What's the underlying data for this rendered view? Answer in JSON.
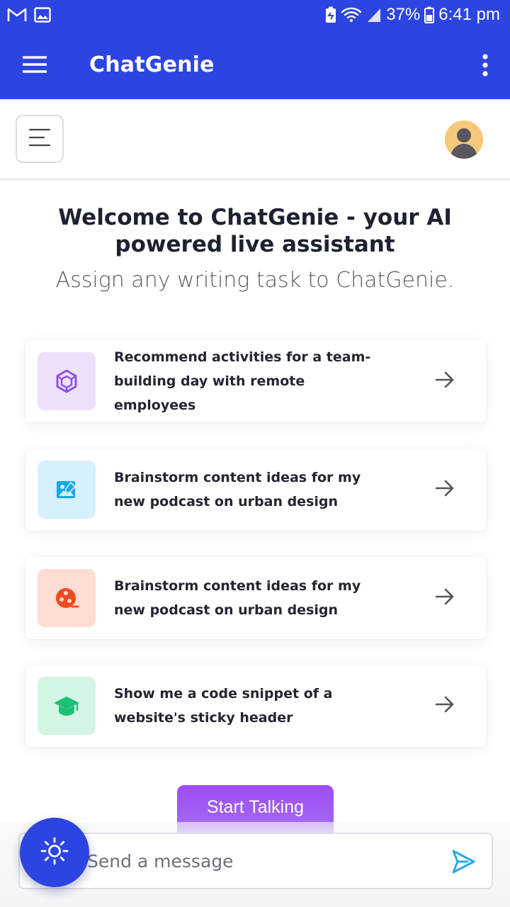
{
  "status_bar": {
    "battery": "37%",
    "time": "6:41 pm",
    "icons": [
      "gmail-icon",
      "gallery-icon",
      "battery-saver-icon",
      "wifi-icon",
      "signal-icon",
      "battery-icon"
    ]
  },
  "app_bar": {
    "title": "ChatGenie",
    "icons": [
      "hamburger-icon",
      "more-vert-icon"
    ]
  },
  "page_header": {
    "icons": [
      "menu-lines-icon",
      "user-avatar-icon"
    ]
  },
  "hero": {
    "title": "Welcome to ChatGenie - your AI powered live assistant",
    "subtitle": "Assign any writing task to ChatGenie."
  },
  "prompts": [
    {
      "text": "Recommend activities for a team-building day with remote employees",
      "icon": "cube-icon",
      "icon_bg": "#ece0fb",
      "icon_color": "#8b4bef"
    },
    {
      "text": "Brainstorm content ideas for my new podcast on urban design",
      "icon": "image-edit-icon",
      "icon_bg": "#d6f1fd",
      "icon_color": "#19a7e6"
    },
    {
      "text": "Brainstorm content ideas for my new podcast on urban design",
      "icon": "film-reel-icon",
      "icon_bg": "#fcdcd3",
      "icon_color": "#ef4b1f"
    },
    {
      "text": "Show me a code snippet of a website's sticky header",
      "icon": "graduation-cap-icon",
      "icon_bg": "#d3f6e4",
      "icon_color": "#1bc177"
    }
  ],
  "start_button": {
    "label": "Start Talking"
  },
  "message_input": {
    "placeholder": "Send a message"
  },
  "colors": {
    "primary_blue": "#2d45e0",
    "accent_purple": "#9f4cf6",
    "send_icon": "#29a9e8"
  }
}
